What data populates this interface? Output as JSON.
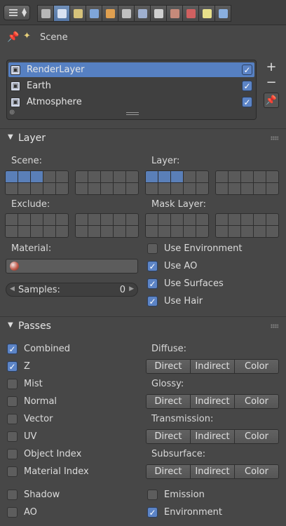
{
  "header": {
    "tabs": [
      {
        "name": "render-tab-icon",
        "color": "#b8b8b8",
        "active": false
      },
      {
        "name": "render-layers-tab-icon",
        "color": "#d9e2f2",
        "active": true
      },
      {
        "name": "scene-tab-icon",
        "color": "#d6c27a",
        "active": false
      },
      {
        "name": "world-tab-icon",
        "color": "#7fa6d9",
        "active": false
      },
      {
        "name": "object-tab-icon",
        "color": "#e0a050",
        "active": false
      },
      {
        "name": "constraints-tab-icon",
        "color": "#c0c0c0",
        "active": false
      },
      {
        "name": "modifiers-tab-icon",
        "color": "#9fb0d0",
        "active": false
      },
      {
        "name": "data-tab-icon",
        "color": "#d0d0d0",
        "active": false
      },
      {
        "name": "material-tab-icon",
        "color": "#c58a7a",
        "active": false
      },
      {
        "name": "texture-tab-icon",
        "color": "#d06060",
        "active": false
      },
      {
        "name": "particles-tab-icon",
        "color": "#e8e08a",
        "active": false
      },
      {
        "name": "physics-tab-icon",
        "color": "#8ab0e0",
        "active": false
      }
    ]
  },
  "scene": {
    "label": "Scene"
  },
  "render_layers": {
    "items": [
      {
        "label": "RenderLayer",
        "selected": true,
        "enabled": true
      },
      {
        "label": "Earth",
        "selected": false,
        "enabled": true
      },
      {
        "label": "Atmosphere",
        "selected": false,
        "enabled": true
      }
    ]
  },
  "layer_panel": {
    "title": "Layer",
    "scene_label": "Scene:",
    "layer_label": "Layer:",
    "exclude_label": "Exclude:",
    "mask_layer_label": "Mask Layer:",
    "scene_active": [
      0,
      1,
      2
    ],
    "layer_active": [
      0,
      1,
      2
    ],
    "material_label": "Material:",
    "samples_label": "Samples:",
    "samples_value": "0",
    "options": [
      {
        "label": "Use Environment",
        "checked": false
      },
      {
        "label": "Use AO",
        "checked": true
      },
      {
        "label": "Use Surfaces",
        "checked": true
      },
      {
        "label": "Use Hair",
        "checked": true
      }
    ]
  },
  "passes_panel": {
    "title": "Passes",
    "left_options": [
      {
        "label": "Combined",
        "checked": true
      },
      {
        "label": "Z",
        "checked": true
      },
      {
        "label": "Mist",
        "checked": false
      },
      {
        "label": "Normal",
        "checked": false
      },
      {
        "label": "Vector",
        "checked": false
      },
      {
        "label": "UV",
        "checked": false
      },
      {
        "label": "Object Index",
        "checked": false
      },
      {
        "label": "Material Index",
        "checked": false
      }
    ],
    "light_groups": [
      {
        "label": "Diffuse:",
        "buttons": [
          "Direct",
          "Indirect",
          "Color"
        ]
      },
      {
        "label": "Glossy:",
        "buttons": [
          "Direct",
          "Indirect",
          "Color"
        ]
      },
      {
        "label": "Transmission:",
        "buttons": [
          "Direct",
          "Indirect",
          "Color"
        ]
      },
      {
        "label": "Subsurface:",
        "buttons": [
          "Direct",
          "Indirect",
          "Color"
        ]
      }
    ],
    "bottom_left": [
      {
        "label": "Shadow",
        "checked": false
      },
      {
        "label": "AO",
        "checked": false
      }
    ],
    "bottom_right": [
      {
        "label": "Emission",
        "checked": false
      },
      {
        "label": "Environment",
        "checked": true
      }
    ]
  }
}
